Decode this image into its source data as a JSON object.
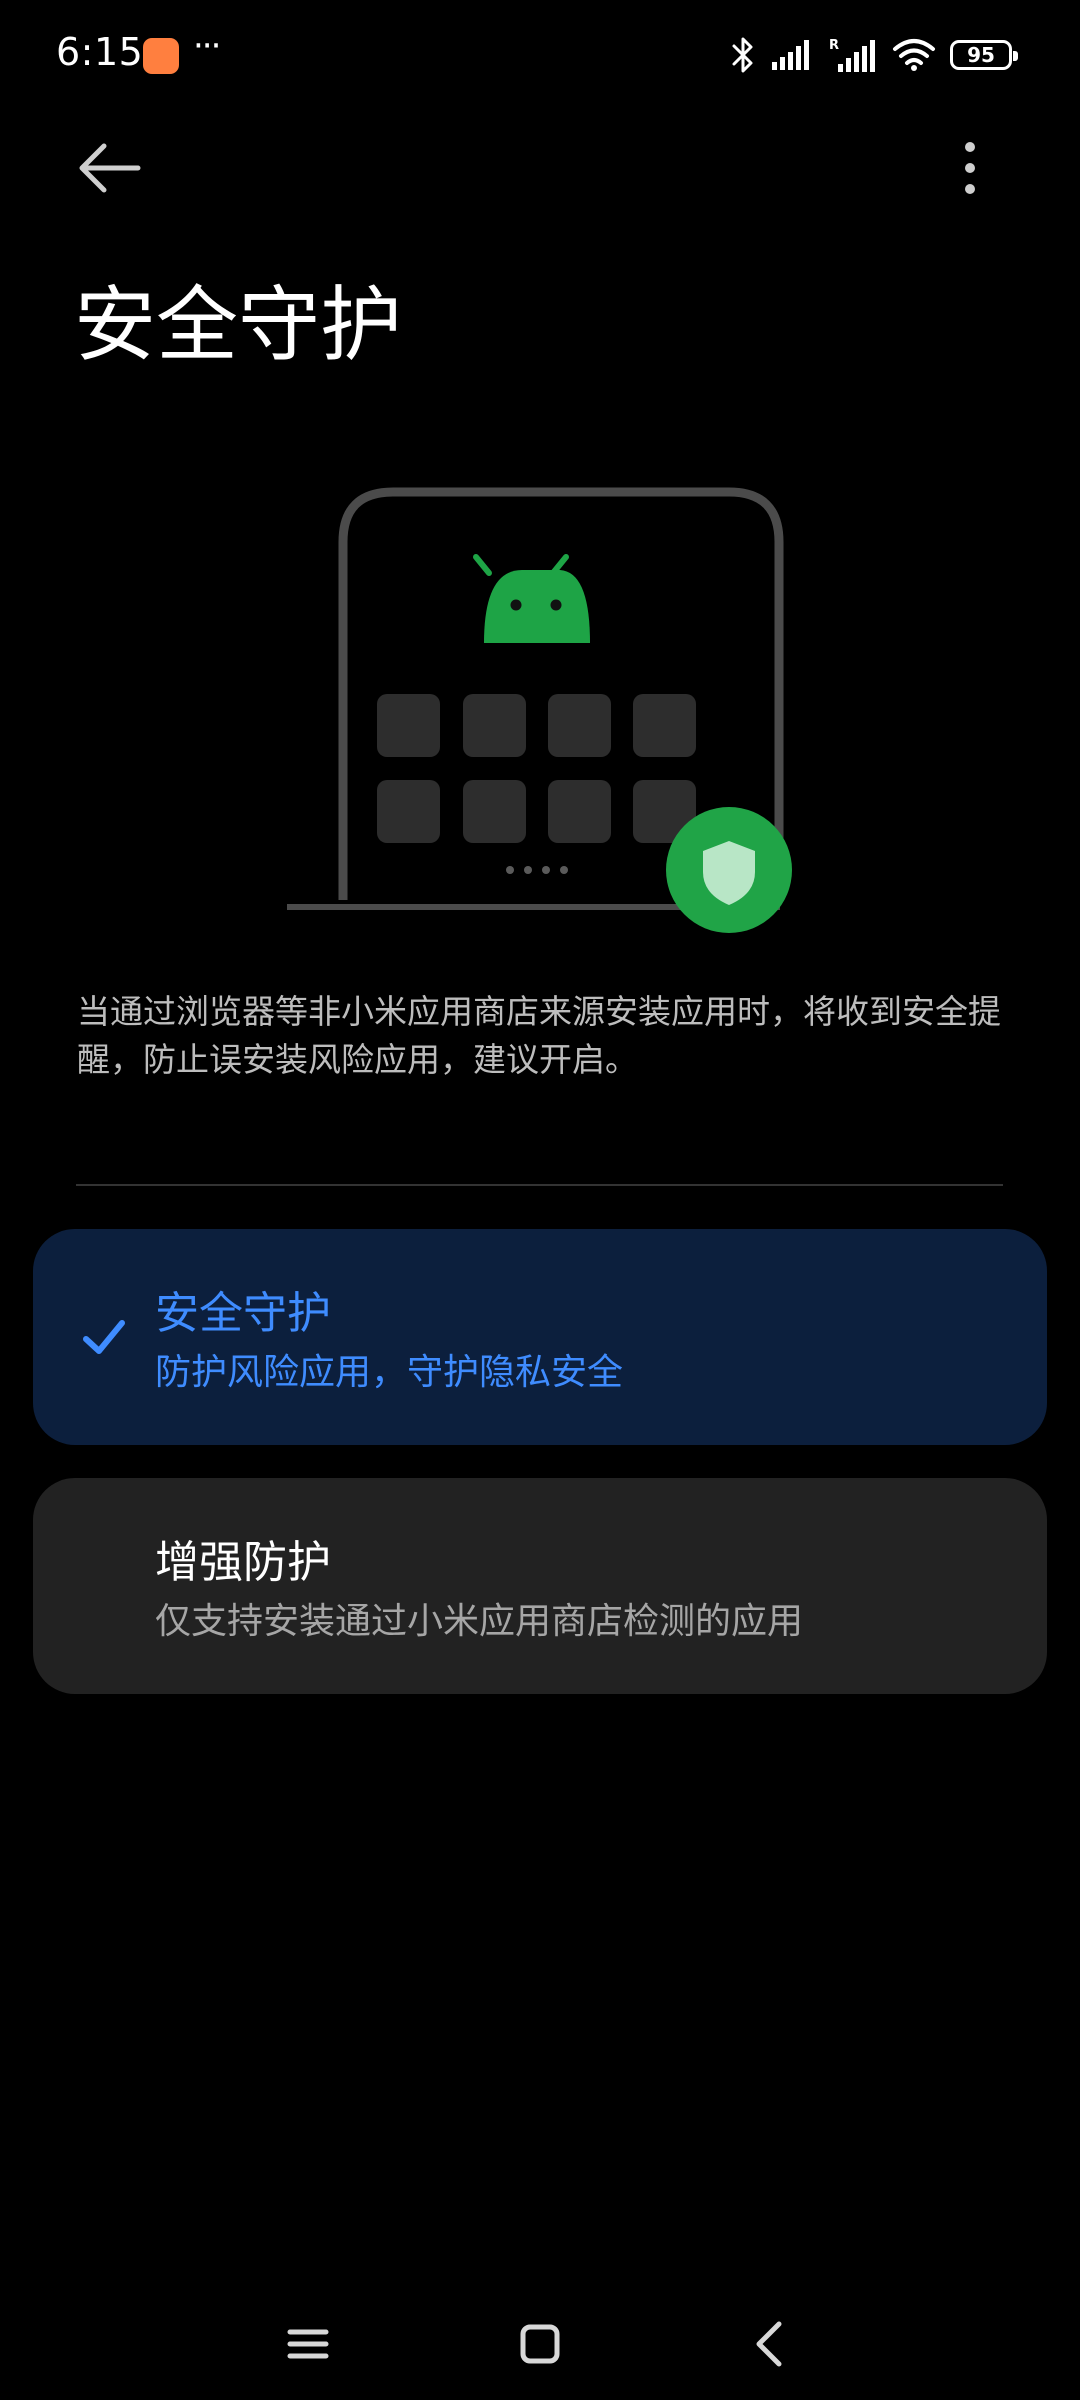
{
  "status_bar": {
    "time": "6:15",
    "notification_more": "···",
    "battery_level": "95",
    "icons": [
      "app-store-notification-icon",
      "bluetooth-icon",
      "cellular-signal-icon",
      "roaming-signal-icon",
      "wifi-icon",
      "battery-icon"
    ]
  },
  "header": {
    "title": "安全守护",
    "back_icon": "back-arrow-icon",
    "more_icon": "more-vertical-icon"
  },
  "description": "当通过浏览器等非小米应用商店来源安装应用时，将收到安全提醒，防止误安装风险应用，建议开启。",
  "options": [
    {
      "title": "安全守护",
      "subtitle": "防护风险应用，守护隐私安全",
      "selected": true
    },
    {
      "title": "增强防护",
      "subtitle": "仅支持安装通过小米应用商店检测的应用",
      "selected": false
    }
  ],
  "colors": {
    "accent": "#3f8cff",
    "selected_bg": "#0c1f3d",
    "card_bg": "#222222",
    "android_green": "#1ea446",
    "shield_green": "#20a447"
  },
  "nav_bar": {
    "icons": [
      "menu-icon",
      "home-icon",
      "back-icon"
    ]
  }
}
